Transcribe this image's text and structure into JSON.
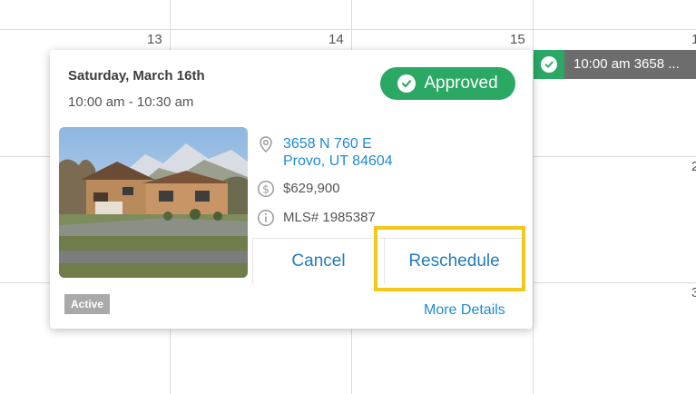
{
  "calendar": {
    "day_numbers": [
      "13",
      "14",
      "15",
      "1",
      "2",
      "3"
    ]
  },
  "event": {
    "label": "10:00 am  3658 ..."
  },
  "popup": {
    "date_title": "Saturday, March 16th",
    "time_range": "10:00 am - 10:30 am",
    "status_pill": "Approved",
    "address_line1": "3658 N 760 E",
    "address_line2": "Provo, UT 84604",
    "price": "$629,900",
    "mls": "MLS# 1985387",
    "cancel_label": "Cancel",
    "reschedule_label": "Reschedule",
    "listing_status": "Active",
    "more_details": "More Details"
  },
  "colors": {
    "approved_green": "#2aa864",
    "link_blue": "#1f8ad0",
    "highlight_yellow": "#f4c81a",
    "event_gray": "#6d6d6d"
  }
}
